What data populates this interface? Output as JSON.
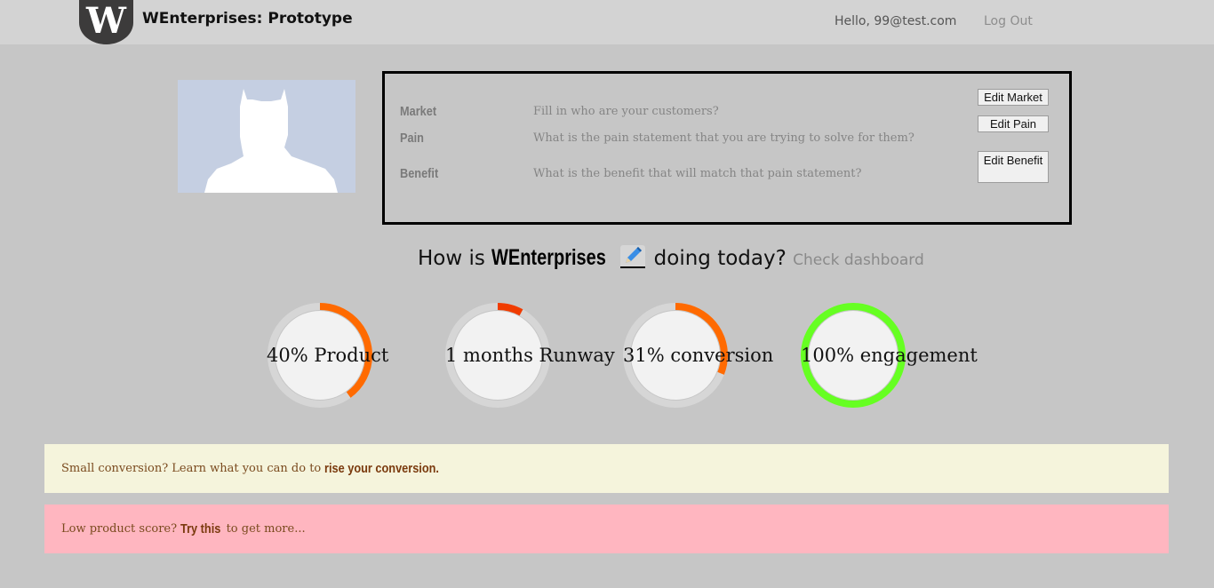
{
  "header": {
    "logo_letter": "W",
    "title": "WEnterprises: Prototype",
    "greeting": "Hello, 99@test.com",
    "logout": "Log Out"
  },
  "profile": {
    "fields": [
      {
        "label": "Market",
        "text": "Fill in who are your customers?"
      },
      {
        "label": "Pain",
        "text": "What is the pain statement that you are trying to solve for them?"
      },
      {
        "label": "Benefit",
        "text": "What is the benefit that will match that pain statement?"
      }
    ],
    "buttons": {
      "edit_market": "Edit Market",
      "edit_pain": "Edit Pain",
      "edit_benefit": "Edit Benefit"
    }
  },
  "headline": {
    "prefix": "How is",
    "company": "WEnterprises",
    "suffix": "doing today?",
    "link": "Check dashboard"
  },
  "gauges": [
    {
      "label": "40% Product",
      "value": 0.4,
      "color": "#ff6a00"
    },
    {
      "label": "1 months Runway",
      "value": 0.08,
      "color": "#f03c00"
    },
    {
      "label": "31% conversion",
      "value": 0.31,
      "color": "#ff6a00"
    },
    {
      "label": "100% engagement",
      "value": 1.0,
      "color": "#66ff22"
    }
  ],
  "alerts": {
    "conversion": {
      "text": "Small conversion? Learn what you can do to",
      "link": "rise your conversion."
    },
    "product": {
      "prefix": "Low product score?",
      "link": "Try this",
      "suffix": "to get more..."
    }
  },
  "colors": {
    "background": "#c6c6c6",
    "header": "#d3d3d3",
    "alert_yellow": "#f5f4dc",
    "alert_pink": "#ffb6c0"
  }
}
